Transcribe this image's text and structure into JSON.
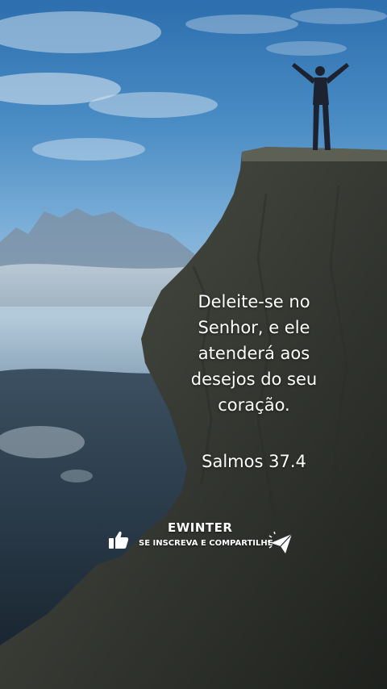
{
  "quote": {
    "lines": [
      "Deleite-se no",
      "Senhor, e ele",
      "atenderá aos",
      "desejos do seu",
      "coração."
    ],
    "reference": "Salmos 37.4"
  },
  "channel": {
    "name": "EWINTER",
    "cta": "SE INSCREVA E COMPARTILHE"
  },
  "icons": {
    "like": "thumbs-up-icon",
    "share": "paper-plane-icon"
  },
  "colors": {
    "text": "#ffffff",
    "sky_top": "#2d6fae",
    "rock": "#3a3d36"
  }
}
